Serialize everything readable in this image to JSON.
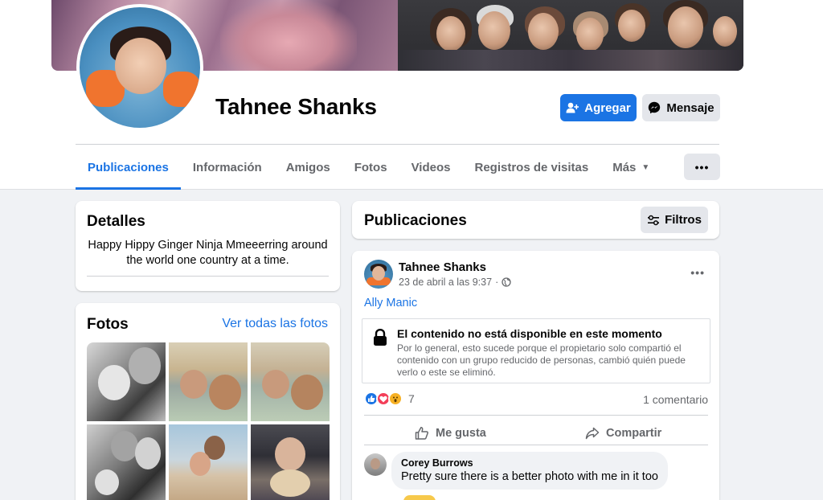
{
  "profile": {
    "name": "Tahnee Shanks",
    "add_label": "Agregar",
    "message_label": "Mensaje"
  },
  "tabs": [
    {
      "label": "Publicaciones",
      "active": true
    },
    {
      "label": "Información"
    },
    {
      "label": "Amigos"
    },
    {
      "label": "Fotos"
    },
    {
      "label": "Videos"
    },
    {
      "label": "Registros de visitas"
    },
    {
      "label": "Más"
    }
  ],
  "more_dots": "•••",
  "details": {
    "title": "Detalles",
    "bio": "Happy Hippy Ginger Ninja Mmeeerring around the world one country at a time."
  },
  "photos": {
    "title": "Fotos",
    "see_all": "Ver todas las fotos"
  },
  "posts_header": {
    "title": "Publicaciones",
    "filters_label": "Filtros"
  },
  "post": {
    "author": "Tahnee Shanks",
    "timestamp": "23 de abril a las 9:37",
    "separator": "·",
    "menu_dots": "•••",
    "link": "Ally Manic",
    "unavailable_title": "El contenido no está disponible en este momento",
    "unavailable_text": "Por lo general, esto sucede porque el propietario solo compartió el contenido con un grupo reducido de personas, cambió quién puede verlo o este se eliminó.",
    "reaction_count": "7",
    "comment_count": "1 comentario",
    "like_label": "Me gusta",
    "share_label": "Compartir"
  },
  "comment": {
    "author": "Corey Burrows",
    "text": "Pretty sure there is a better photo with me in it too"
  },
  "colors": {
    "accent": "#1b74e4",
    "background": "#f0f2f5",
    "secondary_text": "#65676b",
    "button_gray": "#e4e6eb"
  }
}
